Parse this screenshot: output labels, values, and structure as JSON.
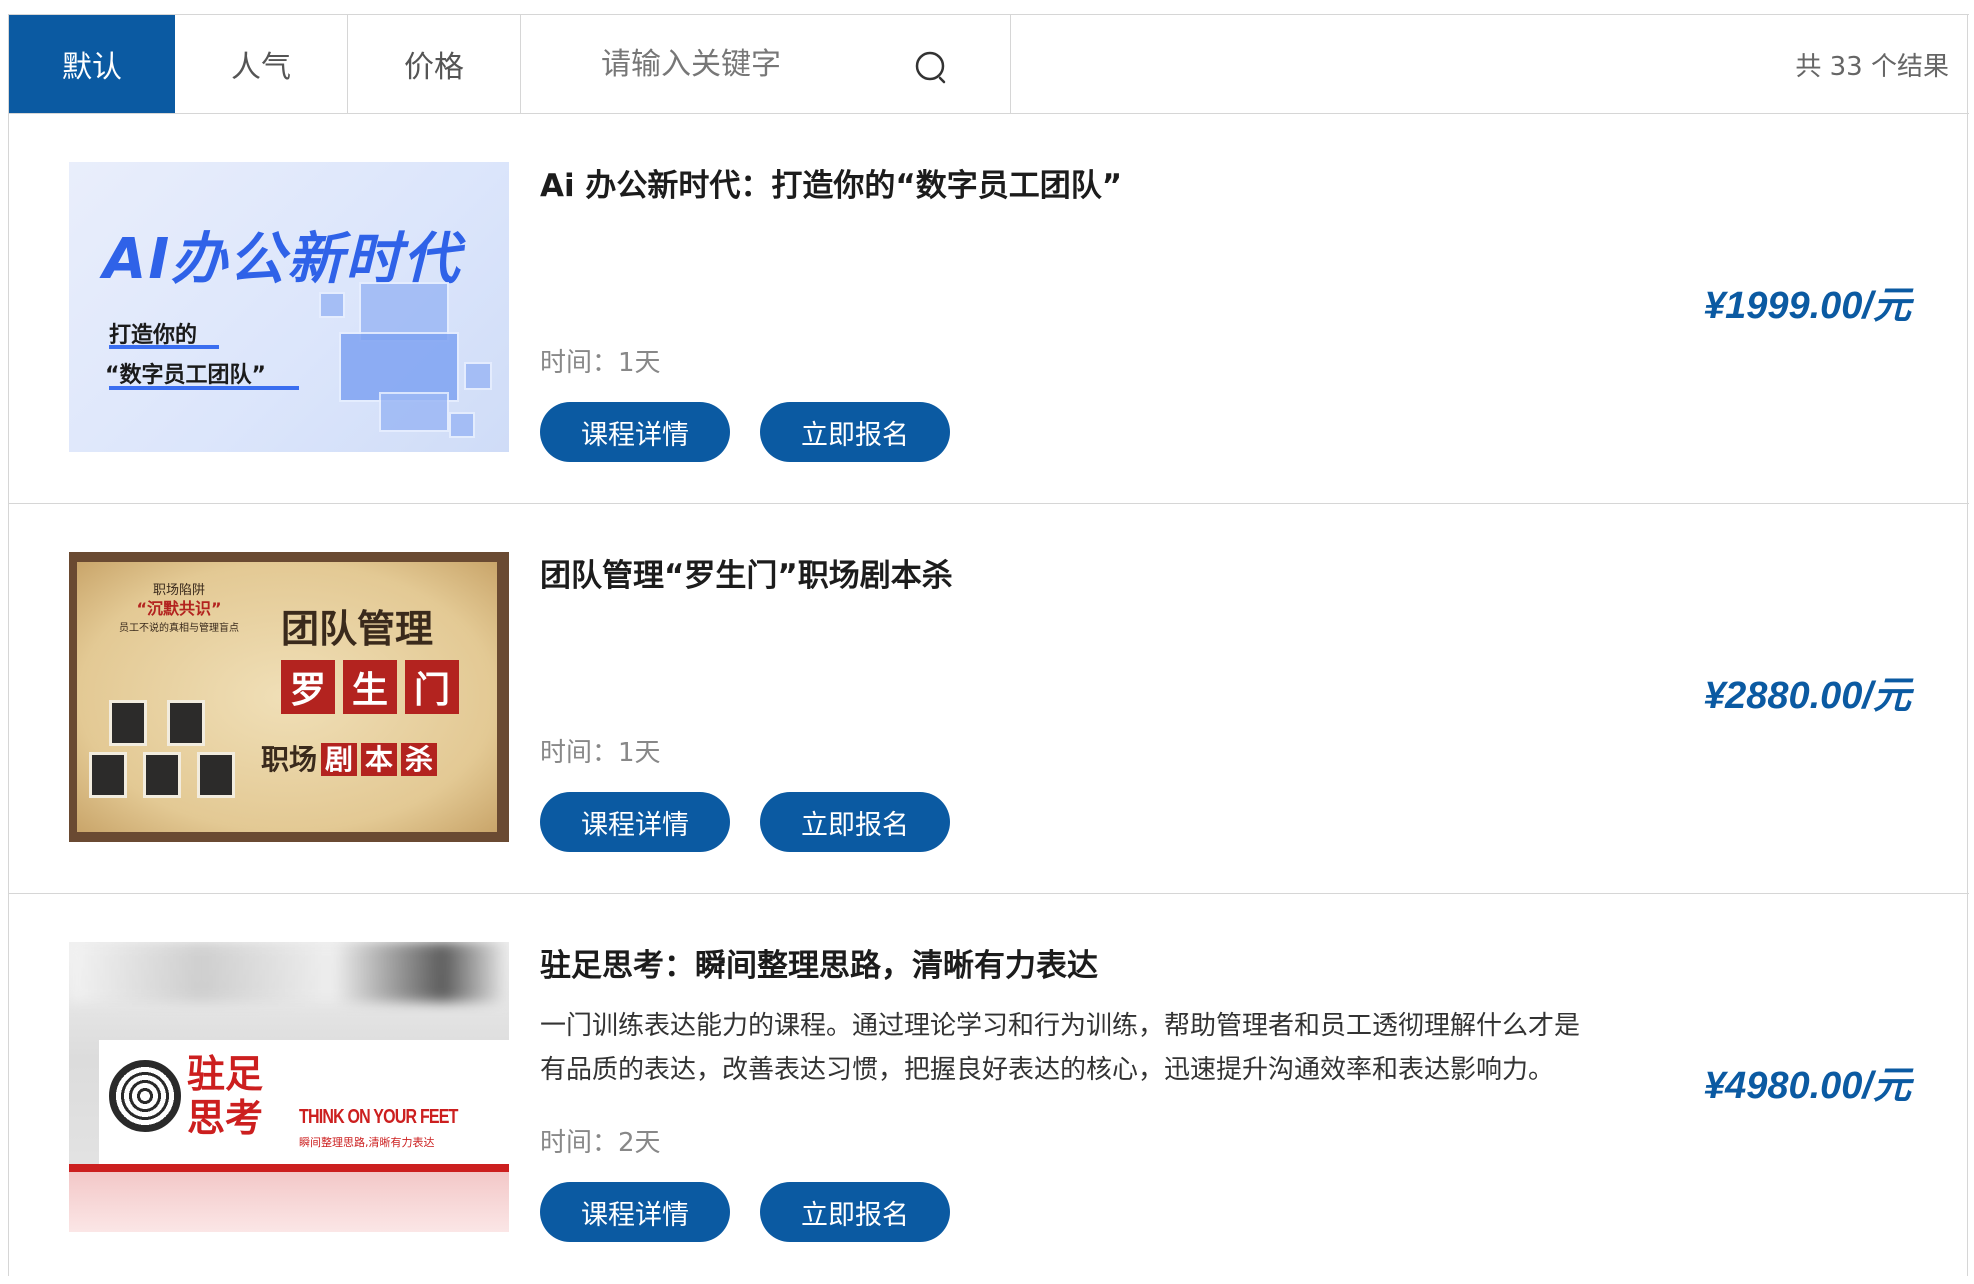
{
  "toolbar": {
    "tabs": [
      {
        "label": "默认",
        "active": true
      },
      {
        "label": "人气",
        "active": false
      },
      {
        "label": "价格",
        "active": false
      }
    ],
    "search": {
      "placeholder": "请输入关键字",
      "value": "",
      "icon": "search-icon"
    },
    "result_count": "共 33 个结果"
  },
  "courses": [
    {
      "title": "Ai 办公新时代：打造你的“数字员工团队”",
      "description": "",
      "duration": "时间：1天",
      "price": "¥1999.00/元",
      "detail_label": "课程详情",
      "enroll_label": "立即报名",
      "thumb": {
        "headline": "AI办公新时代",
        "line1": "打造你的",
        "line2": "“数字员工团队”"
      }
    },
    {
      "title": "团队管理“罗生门”职场剧本杀",
      "description": "",
      "duration": "时间：1天",
      "price": "¥2880.00/元",
      "detail_label": "课程详情",
      "enroll_label": "立即报名",
      "thumb": {
        "headline": "团队管理",
        "red_chars": [
          "罗",
          "生",
          "门"
        ],
        "note_title": "职场陷阱",
        "note_quote": "“沉默共识”",
        "note_sub": "员工不说的真相与管理盲点",
        "row3_plain": "职场",
        "row3_red": [
          "剧",
          "本",
          "杀"
        ]
      }
    },
    {
      "title": "驻足思考：瞬间整理思路，清晰有力表达",
      "description": "一门训练表达能力的课程。通过理论学习和行为训练，帮助管理者和员工透彻理解什么才是有品质的表达，改善表达习惯，把握良好表达的核心，迅速提升沟通效率和表达影响力。",
      "duration": "时间：2天",
      "price": "¥4980.00/元",
      "detail_label": "课程详情",
      "enroll_label": "立即报名",
      "thumb": {
        "cn_line1": "驻足",
        "cn_line2": "思考",
        "en": "THINK ON YOUR FEET",
        "sub": "瞬间整理思路,清晰有力表达"
      }
    }
  ],
  "colors": {
    "brand": "#0b5aa2",
    "border": "#d6d6d6"
  }
}
